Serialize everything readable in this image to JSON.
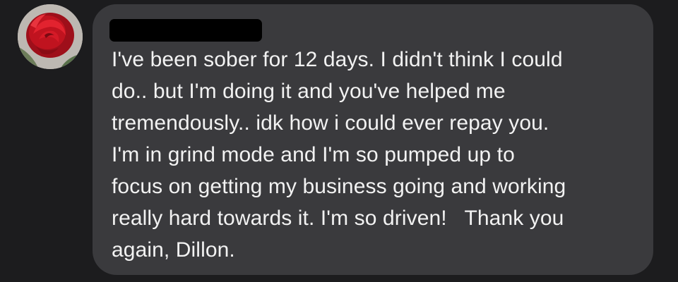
{
  "conversation": {
    "message": {
      "text": "I've been sober for 12 days. I didn't think I could\ndo.. but I'm doing it and you've helped me\ntremendously.. idk how i could ever repay you.\nI'm in grind mode and I'm so pumped up to\nfocus on getting my business going and working\nreally hard towards it. I'm so driven!   Thank you\nagain, Dillon."
    }
  },
  "colors": {
    "background": "#1c1c1e",
    "bubble": "#3a3a3d",
    "text": "#f2f2f2",
    "redaction": "#000000"
  },
  "icons": {
    "avatar": "red-rose-photo"
  }
}
